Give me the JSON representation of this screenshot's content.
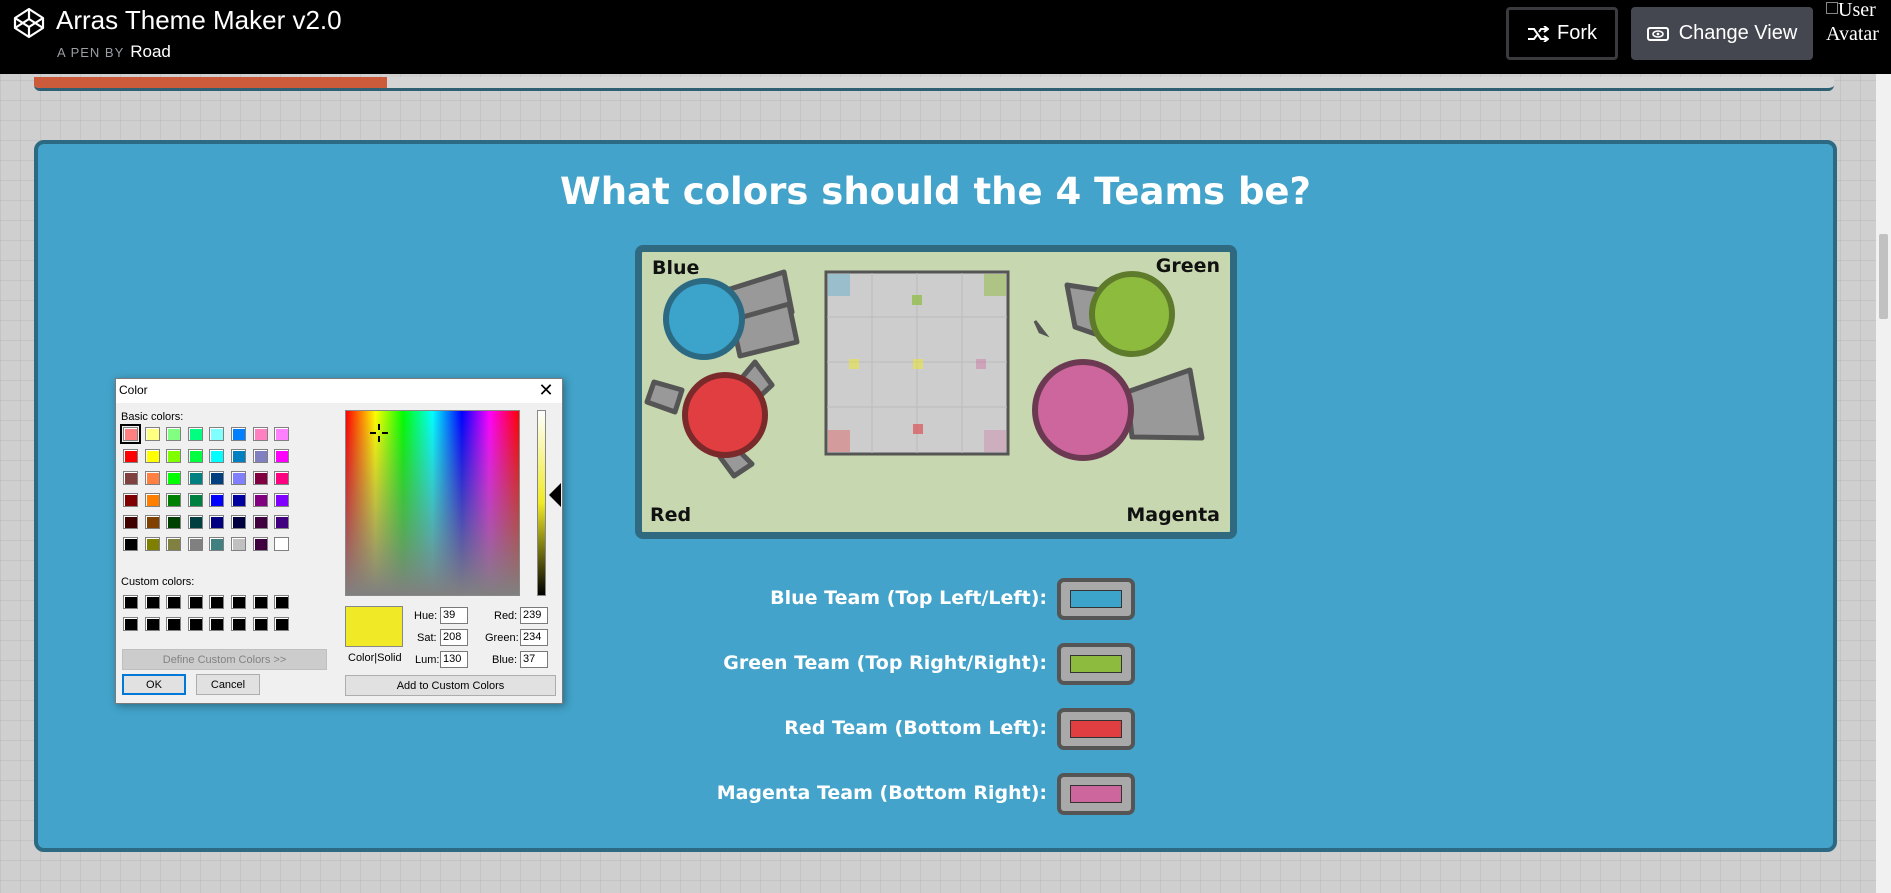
{
  "header": {
    "title": "Arras Theme Maker v2.0",
    "by_prefix": "A PEN BY",
    "author": "Road",
    "fork_label": "Fork",
    "change_view_label": "Change View",
    "avatar_alt": "User Avatar",
    "icons": [
      "codepen-logo-icon",
      "fork-icon",
      "eye-icon"
    ]
  },
  "progress": {
    "fraction": 0.196,
    "fill_color": "#cc5b3b"
  },
  "panel": {
    "title": "What colors should the 4 Teams be?",
    "background": "#43a3ca"
  },
  "preview": {
    "labels": {
      "top_left": "Blue",
      "top_right": "Green",
      "bottom_left": "Red",
      "bottom_right": "Magenta"
    },
    "colors": {
      "blue": "#3ca4cb",
      "green": "#8dbb3d",
      "red": "#e03e41",
      "magenta": "#cc669c",
      "barrel": "#999999",
      "background": "#c7d8b0",
      "arena": "#cdcdcd"
    }
  },
  "teams": [
    {
      "label": "Blue Team (Top Left/Left):",
      "color": "#3ca4cb"
    },
    {
      "label": "Green Team (Top Right/Right):",
      "color": "#8dbb3d"
    },
    {
      "label": "Red Team (Bottom Left):",
      "color": "#e03e41"
    },
    {
      "label": "Magenta Team (Bottom Right):",
      "color": "#cc669c"
    }
  ],
  "color_dialog": {
    "title": "Color",
    "close_icon": "close-icon",
    "basic_colors_label": "Basic colors:",
    "custom_colors_label": "Custom colors:",
    "define_custom_label": "Define Custom Colors >>",
    "ok_label": "OK",
    "cancel_label": "Cancel",
    "color_solid_label": "Color|Solid",
    "add_custom_label": "Add to Custom Colors",
    "hue_label": "Hue:",
    "sat_label": "Sat:",
    "lum_label": "Lum:",
    "red_label": "Red:",
    "green_label": "Green:",
    "blue_label": "Blue:",
    "hue": "39",
    "sat": "208",
    "lum": "130",
    "red": "239",
    "green": "234",
    "blue": "37",
    "current_color": "#efea25",
    "basic_colors": [
      "#ff8080",
      "#ffff80",
      "#80ff80",
      "#00ff80",
      "#80ffff",
      "#0080ff",
      "#ff80c0",
      "#ff80ff",
      "#ff0000",
      "#ffff00",
      "#80ff00",
      "#00ff40",
      "#00ffff",
      "#0080c0",
      "#8080c0",
      "#ff00ff",
      "#804040",
      "#ff8040",
      "#00ff00",
      "#008080",
      "#004080",
      "#8080ff",
      "#800040",
      "#ff0080",
      "#800000",
      "#ff8000",
      "#008000",
      "#008040",
      "#0000ff",
      "#0000a0",
      "#800080",
      "#8000ff",
      "#400000",
      "#804000",
      "#004000",
      "#004040",
      "#000080",
      "#000040",
      "#400040",
      "#400080",
      "#000000",
      "#808000",
      "#808040",
      "#808080",
      "#408080",
      "#c0c0c0",
      "#400040",
      "#ffffff"
    ],
    "custom_colors": [
      "#000000",
      "#000000",
      "#000000",
      "#000000",
      "#000000",
      "#000000",
      "#000000",
      "#000000",
      "#000000",
      "#000000",
      "#000000",
      "#000000",
      "#000000",
      "#000000",
      "#000000",
      "#000000"
    ]
  }
}
